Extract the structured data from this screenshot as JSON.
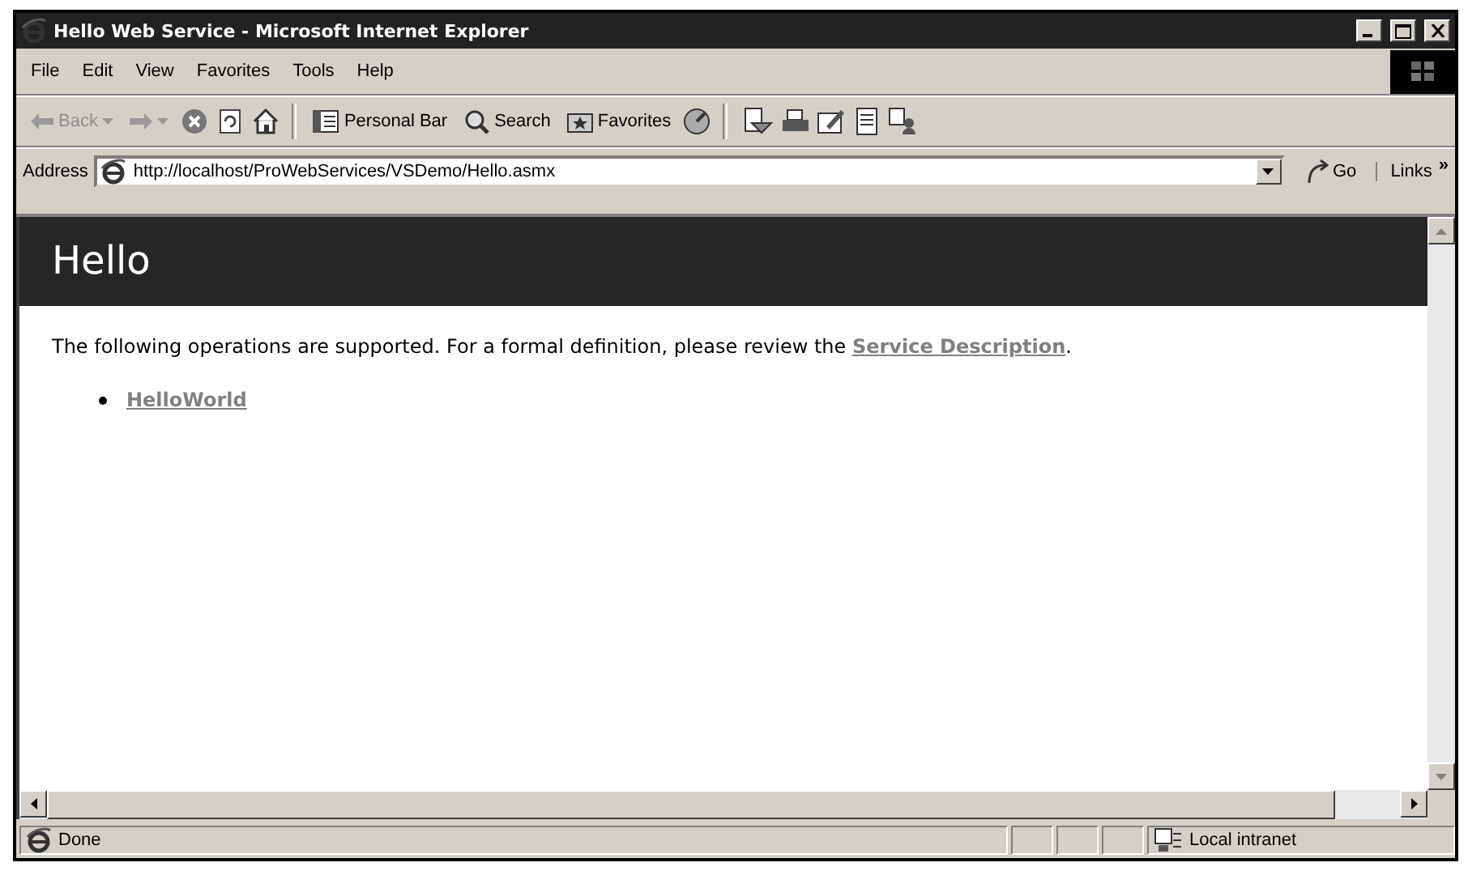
{
  "window": {
    "title": "Hello Web Service - Microsoft Internet Explorer"
  },
  "menu": [
    "File",
    "Edit",
    "View",
    "Favorites",
    "Tools",
    "Help"
  ],
  "toolbar": {
    "back": {
      "label": "Back",
      "disabled": true
    },
    "personal_bar": "Personal Bar",
    "search": "Search",
    "favorites": "Favorites"
  },
  "address_bar": {
    "label": "Address",
    "value": "http://localhost/ProWebServices/VSDemo/Hello.asmx",
    "go": "Go",
    "links": "Links",
    "chevron": "»"
  },
  "page": {
    "heading": "Hello",
    "intro": "The following operations are supported. For a formal definition, please review the ",
    "intro_link": "Service Description",
    "intro_end": ".",
    "operations": [
      "HelloWorld"
    ]
  },
  "status_bar": {
    "text": "Done",
    "zone": "Local intranet"
  }
}
